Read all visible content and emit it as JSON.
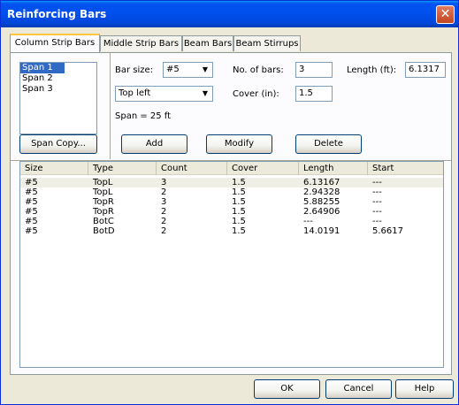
{
  "window": {
    "title": "Reinforcing Bars"
  },
  "tabs": [
    "Column Strip Bars",
    "Middle Strip Bars",
    "Beam Bars",
    "Beam Stirrups"
  ],
  "spans": {
    "items": [
      "Span 1",
      "Span 2",
      "Span 3"
    ],
    "selected": 0
  },
  "form": {
    "bar_size_label": "Bar size:",
    "bar_size_value": "#5",
    "position_value": "Top left",
    "span_text": "Span = 25 ft",
    "no_of_bars_label": "No. of bars:",
    "no_of_bars_value": "3",
    "cover_label": "Cover (in):",
    "cover_value": "1.5",
    "length_label": "Length (ft):",
    "length_value": "6.1317"
  },
  "buttons": {
    "span_copy": "Span Copy...",
    "add": "Add",
    "modify": "Modify",
    "delete": "Delete",
    "ok": "OK",
    "cancel": "Cancel",
    "help": "Help"
  },
  "table": {
    "columns": [
      "Size",
      "Type",
      "Count",
      "Cover",
      "Length",
      "Start"
    ],
    "rows": [
      [
        "#5",
        "TopL",
        "3",
        "1.5",
        "6.13167",
        "---"
      ],
      [
        "#5",
        "TopL",
        "2",
        "1.5",
        "2.94328",
        "---"
      ],
      [
        "#5",
        "TopR",
        "3",
        "1.5",
        "5.88255",
        "---"
      ],
      [
        "#5",
        "TopR",
        "2",
        "1.5",
        "2.64906",
        "---"
      ],
      [
        "#5",
        "BotC",
        "2",
        "1.5",
        "---",
        "---"
      ],
      [
        "#5",
        "BotD",
        "2",
        "1.5",
        "14.0191",
        "5.6617"
      ]
    ]
  }
}
